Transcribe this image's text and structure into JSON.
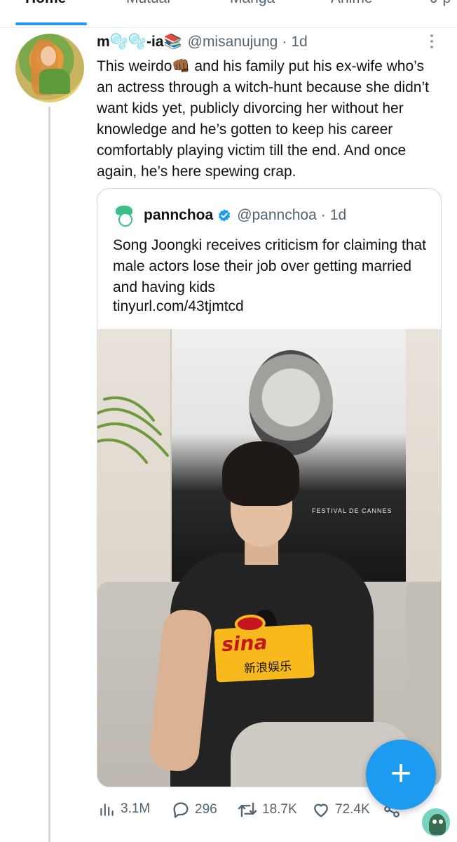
{
  "tabs": [
    {
      "label": "Home",
      "active": true
    },
    {
      "label": "Mutual",
      "active": false
    },
    {
      "label": "Manga",
      "active": false
    },
    {
      "label": "Anime",
      "active": false
    },
    {
      "label": "J-p",
      "active": false
    }
  ],
  "tweet": {
    "display_name": "m🫧🫧-ia📚",
    "handle": "@misanujung",
    "time": "1d",
    "text": "This weirdo👊🏾 and his family put his ex-wife who’s an actress through a witch-hunt because she didn’t want kids yet, publicly divorcing her without her knowledge and he’s gotten to keep his career comfortably playing victim till the end. And once again, he’s here spewing crap.",
    "quote": {
      "display_name": "pannchoa",
      "verified": true,
      "handle": "@pannchoa",
      "time": "1d",
      "text": "Song Joongki receives criticism for claiming that male actors lose their job over getting married and having kids",
      "link": "tinyurl.com/43tjmtcd",
      "image": {
        "sina_logo": "sina",
        "sina_caption": "新浪娱乐",
        "poster_caption": "FESTIVAL DE CANNES"
      }
    },
    "stats": {
      "views": "3.1M",
      "replies": "296",
      "retweets": "18.7K",
      "likes": "72.4K"
    }
  },
  "colors": {
    "accent": "#1d9bf0",
    "text_primary": "#0f1419",
    "text_secondary": "#536471",
    "border": "#cfd9de"
  },
  "icons": {
    "more": "more-vertical-icon",
    "verified": "verified-badge-icon",
    "views": "analytics-icon",
    "reply": "reply-icon",
    "retweet": "retweet-icon",
    "like": "heart-icon",
    "share": "share-icon",
    "compose": "plus-icon"
  }
}
